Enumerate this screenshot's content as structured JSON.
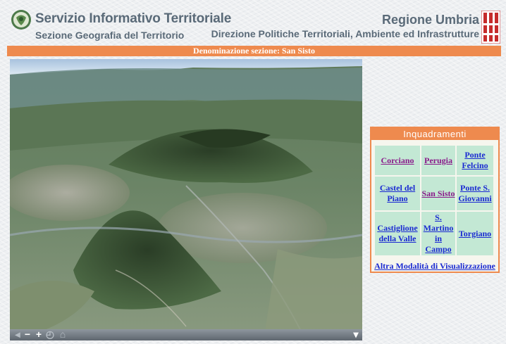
{
  "header": {
    "title": "Servizio Informativo Territoriale",
    "subtitle": "Sezione Geografia del Territorio",
    "region_title": "Regione Umbria",
    "region_subtitle": "Direzione Politiche Territoriali, Ambiente ed Infrastrutture"
  },
  "section_bar": {
    "text": "Denominazione sezione: San Sisto"
  },
  "map": {
    "description_icon": "aerial-3d-terrain-view",
    "controls": [
      "left-arrow-icon",
      "minus-icon",
      "plus-icon",
      "rotate-icon",
      "reset-icon",
      "dropdown-arrow-icon"
    ],
    "control_glyphs": {
      "left": "◂",
      "minus": "−",
      "plus": "+",
      "rotate": "◴",
      "reset": "⌂",
      "menu": "▾"
    }
  },
  "panel": {
    "title": "Inquadramenti",
    "rows": [
      [
        {
          "label": "Corciano",
          "visited": true
        },
        {
          "label": "Perugia",
          "visited": true
        },
        {
          "label": "Ponte Felcino",
          "visited": false
        }
      ],
      [
        {
          "label": "Castel del Piano",
          "visited": false
        },
        {
          "label": "San Sisto",
          "visited": true
        },
        {
          "label": "Ponte S. Giovanni",
          "visited": false
        }
      ],
      [
        {
          "label": "Castiglione della Valle",
          "visited": false
        },
        {
          "label": "S. Martino in Campo",
          "visited": false
        },
        {
          "label": "Torgiano",
          "visited": false
        }
      ]
    ],
    "alt_link": "Altra Modalità di Visualizzazione"
  },
  "colors": {
    "accent": "#ee8a4e",
    "cell": "#c3e8d4",
    "link": "#1a2ad2",
    "visited": "#8a1a8a",
    "header_text": "#5a6a78"
  }
}
